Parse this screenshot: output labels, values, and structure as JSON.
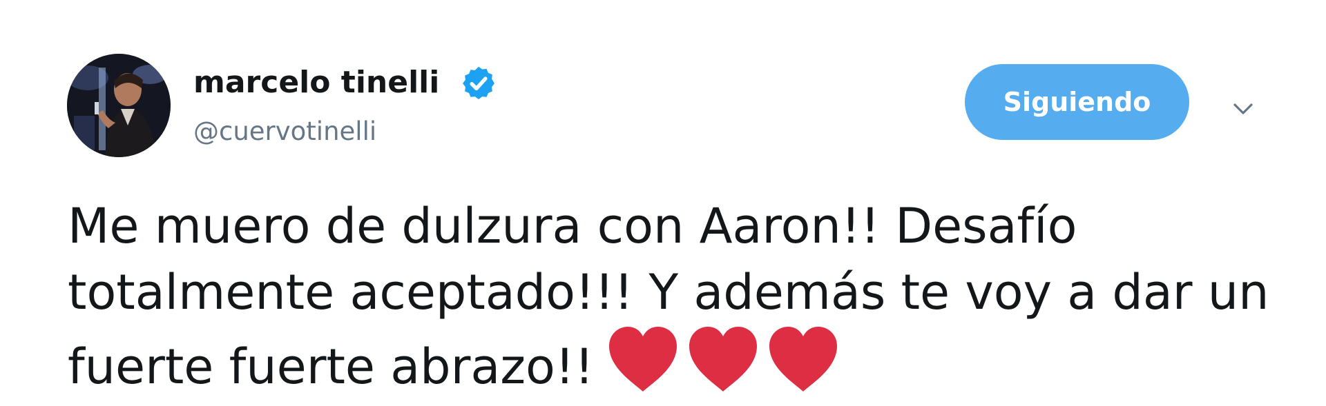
{
  "author": {
    "name": "marcelo tinelli",
    "handle": "@cuervotinelli",
    "verified": true
  },
  "follow_button": {
    "label": "Siguiendo"
  },
  "tweet": {
    "text": "Me muero de dulzura con Aaron!! Desafío totalmente aceptado!!! Y además te voy a dar un fuerte fuerte abrazo!!",
    "emojis": [
      "heart-icon",
      "heart-icon",
      "heart-icon"
    ]
  },
  "colors": {
    "accent": "#55acee",
    "verified": "#1da1f2",
    "heart": "#dd2e44",
    "text": "#14171a",
    "muted": "#657786"
  }
}
